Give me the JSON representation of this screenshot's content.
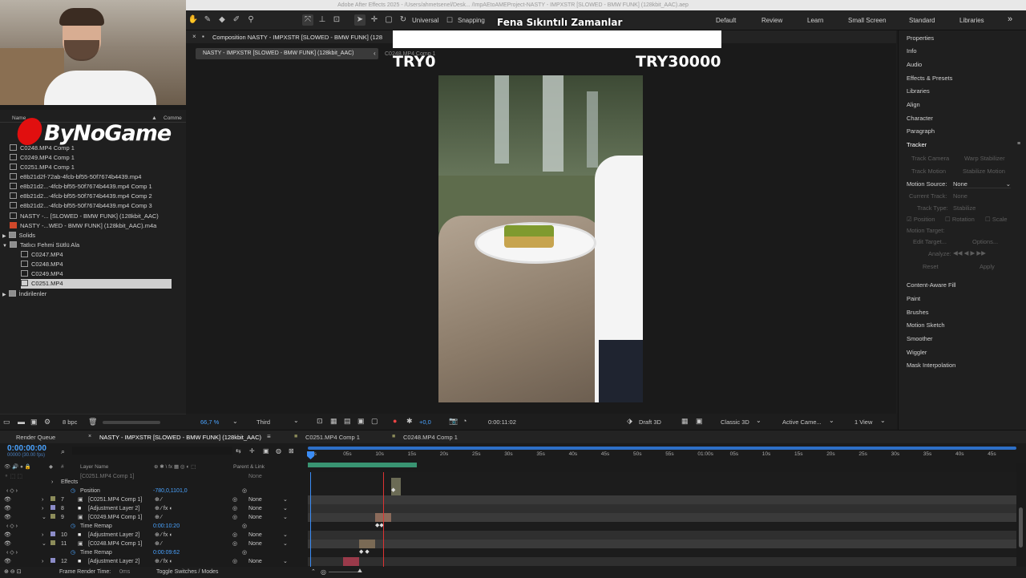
{
  "title": "Adobe After Effects 2025 - /Users/ahmetsenel/Desk... /ImpAEtoAMEProject-NASTY - IMPXSTR [SLOWED - BMW FUNK] (128kbit_AAC).aep",
  "toolbar": {
    "universal": "Universal",
    "snapping": "Snapping",
    "workspaces": [
      "Default",
      "Review",
      "Learn",
      "Small Screen",
      "Standard",
      "Libraries"
    ],
    "more": "»"
  },
  "overlay": {
    "headline": "Fena Sıkıntılı Zamanlar",
    "left_value": "TRY0",
    "right_value": "TRY30000"
  },
  "webcam_logo": "ByNoGame",
  "project": {
    "col_name": "Name",
    "col_comment": "Comme",
    "items": [
      {
        "name": "C0248.MP4 Comp 1",
        "type": "comp"
      },
      {
        "name": "C0249.MP4 Comp 1",
        "type": "comp"
      },
      {
        "name": "C0251.MP4 Comp 1",
        "type": "comp"
      },
      {
        "name": "e8b21d2f-72ab-4fcb-bf55-50f7674b4439.mp4",
        "type": "footage"
      },
      {
        "name": "e8b21d2...-4fcb-bf55-50f7674b4439.mp4 Comp 1",
        "type": "comp"
      },
      {
        "name": "e8b21d2...-4fcb-bf55-50f7674b4439.mp4 Comp 2",
        "type": "comp"
      },
      {
        "name": "e8b21d2...-4fcb-bf55-50f7674b4439.mp4 Comp 3",
        "type": "comp"
      },
      {
        "name": "NASTY -... [SLOWED - BMW FUNK] (128kbit_AAC)",
        "type": "comp"
      },
      {
        "name": "NASTY -...WED - BMW FUNK] (128kbit_AAC).m4a",
        "type": "audio"
      },
      {
        "name": "Solids",
        "type": "folder"
      },
      {
        "name": "Tatlıcı Fehmi Sütlü Ala",
        "type": "folder"
      },
      {
        "name": "C0247.MP4",
        "type": "footage"
      },
      {
        "name": "C0248.MP4",
        "type": "footage"
      },
      {
        "name": "C0249.MP4",
        "type": "footage"
      },
      {
        "name": "C0251.MP4",
        "type": "footage"
      },
      {
        "name": "İndirilenler",
        "type": "folder"
      }
    ],
    "bit_depth": "8 bpc"
  },
  "composition": {
    "panel_title": "Composition NASTY - IMPXSTR [SLOWED - BMW FUNK] (128",
    "tab_label": "NASTY - IMPXSTR [SLOWED - BMW FUNK] (128kbit_AAC)",
    "breadcrumb": "C0248.MP4 Comp 1",
    "zoom": "66,7 %",
    "resolution": "Third",
    "exposure": "+0,0",
    "timecode": "0:00:11:02",
    "draft": "Draft 3D",
    "renderer": "Classic 3D",
    "camera": "Active Came...",
    "views": "1 View"
  },
  "right_panel": {
    "items": [
      "Properties",
      "Info",
      "Audio",
      "Effects & Presets",
      "Libraries",
      "Align",
      "Character",
      "Paragraph",
      "Tracker"
    ],
    "tracker": {
      "track_camera": "Track Camera",
      "warp_stabilizer": "Warp Stabilizer",
      "track_motion": "Track Motion",
      "stabilize_motion": "Stabilize Motion",
      "motion_source_label": "Motion Source:",
      "motion_source_value": "None",
      "current_track_label": "Current Track:",
      "current_track_value": "None",
      "track_type_label": "Track Type:",
      "track_type_value": "Stabilize",
      "position": "Position",
      "rotation": "Rotation",
      "scale": "Scale",
      "motion_target": "Motion Target:",
      "edit_target": "Edit Target...",
      "options": "Options...",
      "analyze": "Analyze:",
      "reset": "Reset",
      "apply": "Apply"
    },
    "lower_items": [
      "Content-Aware Fill",
      "Paint",
      "Brushes",
      "Motion Sketch",
      "Smoother",
      "Wiggler",
      "Mask Interpolation"
    ]
  },
  "timeline": {
    "render_queue": "Render Queue",
    "tabs": [
      "NASTY - IMPXSTR [SLOWED - BMW FUNK] (128kbit_AAC)",
      "C0251.MP4 Comp 1",
      "C0248.MP4 Comp 1"
    ],
    "timecode": "0:00:00:00",
    "fps": "00000 (30.00 fps)",
    "col_layer_name": "Layer Name",
    "col_parent": "Parent & Link",
    "ruler": [
      "0s",
      "05s",
      "10s",
      "15s",
      "20s",
      "25s",
      "30s",
      "35s",
      "40s",
      "45s",
      "50s",
      "55s",
      "01:00s",
      "05s",
      "10s",
      "15s",
      "20s",
      "25s",
      "30s",
      "35s",
      "40s",
      "45s"
    ],
    "rows": [
      {
        "kind": "prop",
        "label": "Effects",
        "value": ""
      },
      {
        "kind": "prop",
        "label": "Position",
        "value": "-780,0,1101,0"
      },
      {
        "kind": "layer",
        "num": "7",
        "name": "[C0251.MP4 Comp 1]",
        "parent": "None",
        "color": "#8c8c5a"
      },
      {
        "kind": "layer",
        "num": "8",
        "name": "[Adjustment Layer 2]",
        "parent": "None",
        "color": "#8c8cc8"
      },
      {
        "kind": "layer",
        "num": "9",
        "name": "[C0249.MP4 Comp 1]",
        "parent": "None",
        "color": "#8c8c5a"
      },
      {
        "kind": "prop",
        "label": "Time Remap",
        "value": "0:00:10:20"
      },
      {
        "kind": "layer",
        "num": "10",
        "name": "[Adjustment Layer 2]",
        "parent": "None",
        "color": "#8c8cc8"
      },
      {
        "kind": "layer",
        "num": "11",
        "name": "[C0248.MP4 Comp 1]",
        "parent": "None",
        "color": "#8c8c5a"
      },
      {
        "kind": "prop",
        "label": "Time Remap",
        "value": "0:00:09:62"
      },
      {
        "kind": "layer",
        "num": "12",
        "name": "[Adjustment Layer 2]",
        "parent": "None",
        "color": "#8c8cc8"
      }
    ],
    "frame_render_time_label": "Frame Render Time:",
    "frame_render_time": "0ms",
    "toggle_label": "Toggle Switches / Modes"
  }
}
